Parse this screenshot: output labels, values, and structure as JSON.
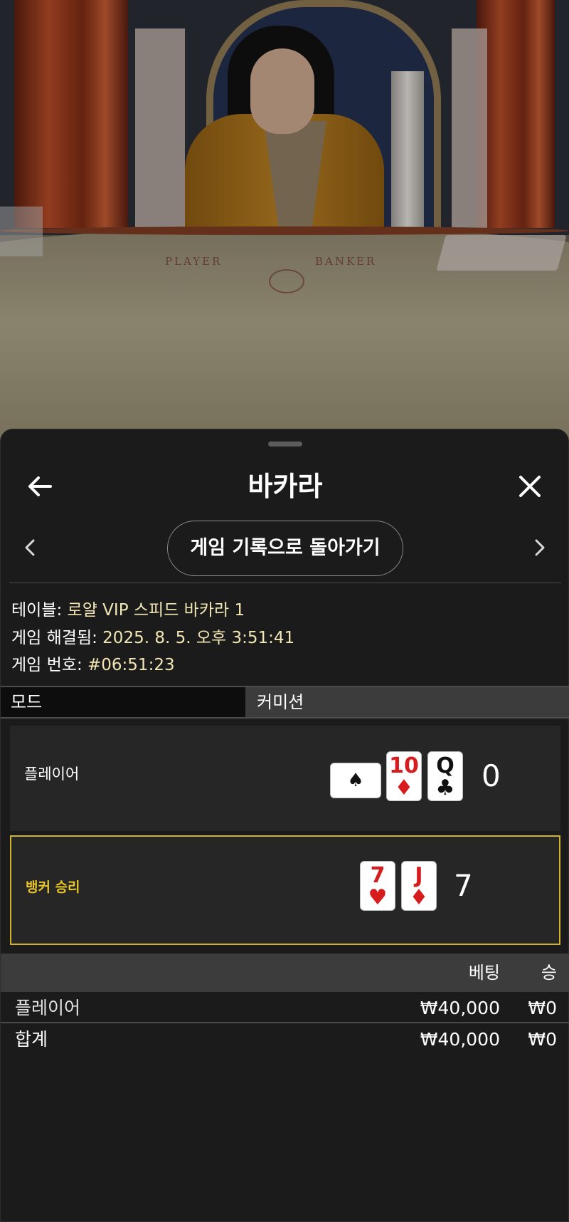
{
  "video": {
    "table_labels": [
      "PLAYER",
      "BANKER"
    ]
  },
  "header": {
    "title": "바카라",
    "back_icon": "arrow-left-icon",
    "close_icon": "close-icon"
  },
  "history_nav": {
    "back_to_history_label": "게임 기록으로 돌아가기",
    "prev_icon": "chevron-left-icon",
    "next_icon": "chevron-right-icon"
  },
  "info": {
    "table_label": "테이블: ",
    "table_value": "로얄 VIP 스피드 바카라 1",
    "resolved_label": "게임 해결됨: ",
    "resolved_value": "2025. 8. 5. 오후 3:51:41",
    "game_number_label": "게임 번호: ",
    "game_number_value": "#06:51:23"
  },
  "mode_bar": {
    "mode_label": "모드",
    "commission_label": "커미션"
  },
  "hands": {
    "player": {
      "label": "플레이어",
      "cards": [
        {
          "rank": "",
          "suit": "♠",
          "orientation": "sideways",
          "color": "black"
        },
        {
          "rank": "10",
          "suit": "♦",
          "color": "red"
        },
        {
          "rank": "Q",
          "suit": "♣",
          "color": "black"
        }
      ],
      "score": "0"
    },
    "banker": {
      "label": "뱅커 승리",
      "cards": [
        {
          "rank": "7",
          "suit": "♥",
          "color": "red"
        },
        {
          "rank": "J",
          "suit": "♦",
          "color": "red"
        }
      ],
      "score": "7",
      "highlight_color": "#d3b22b"
    }
  },
  "bets": {
    "headers": {
      "bet": "베팅",
      "win": "승"
    },
    "rows": [
      {
        "label": "플레이어",
        "bet": "₩40,000",
        "win": "₩0"
      },
      {
        "label": "합계",
        "bet": "₩40,000",
        "win": "₩0"
      }
    ]
  }
}
